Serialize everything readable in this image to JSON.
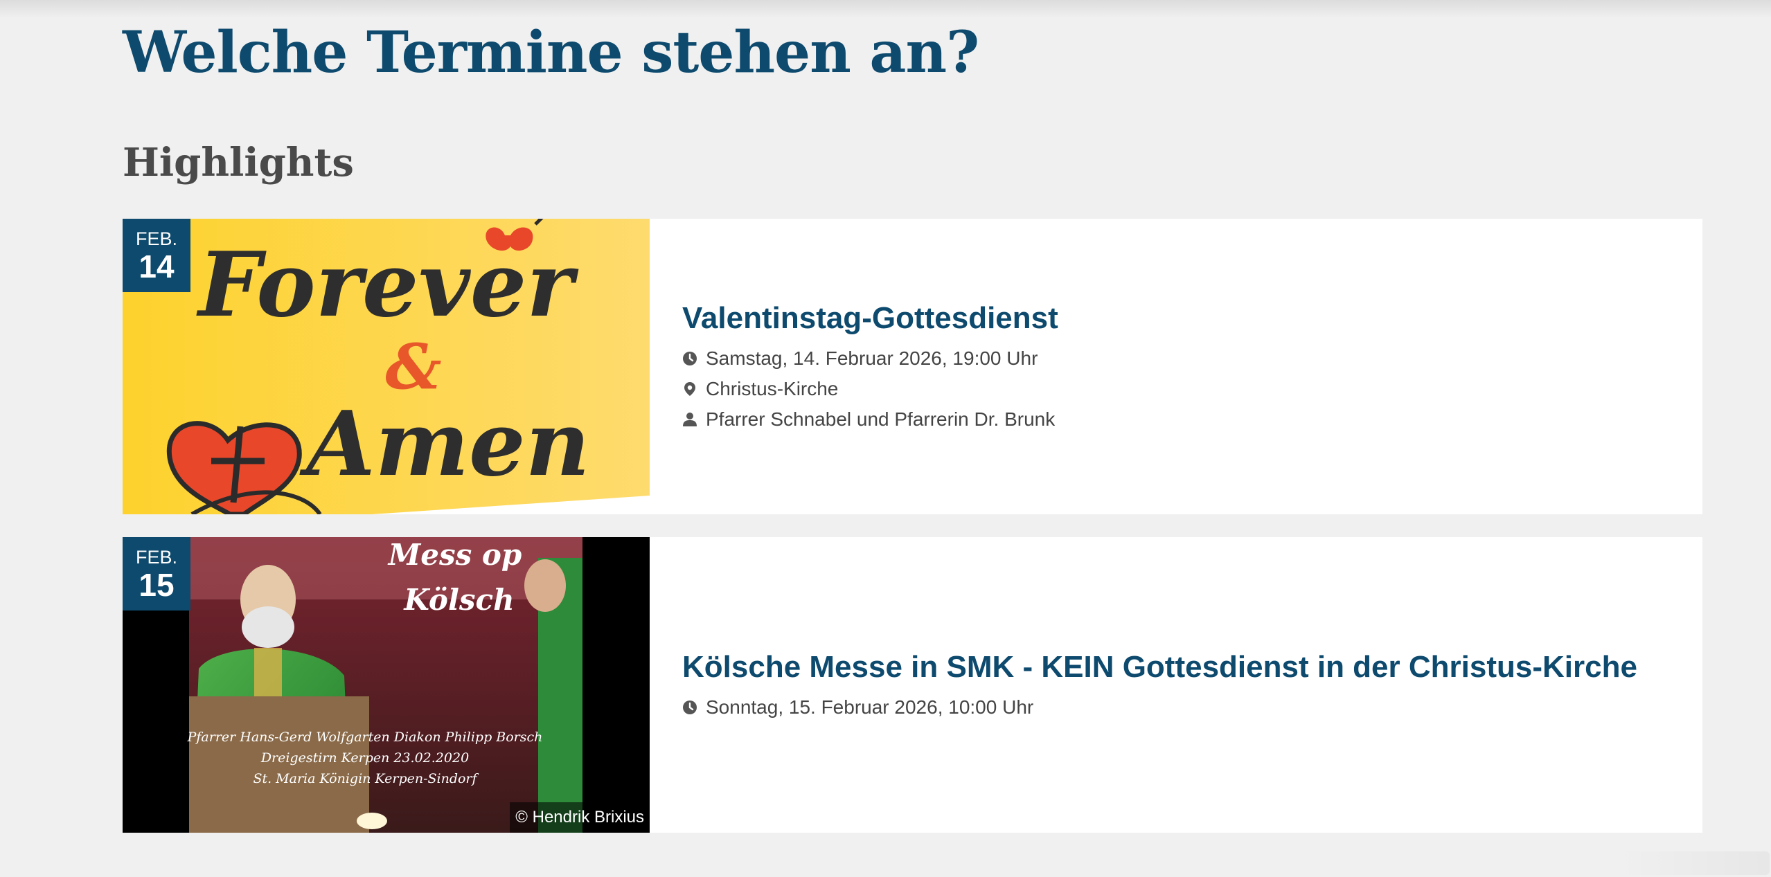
{
  "page": {
    "title": "Welche Termine stehen an?",
    "section_title": "Highlights"
  },
  "colors": {
    "accent": "#0d4a6e",
    "background": "#f0f0f0",
    "card": "#ffffff",
    "section_title": "#4a4a4a"
  },
  "events": [
    {
      "month": "FEB.",
      "day": "14",
      "title": "Valentinstag-Gottesdienst",
      "datetime": "Samstag, 14. Februar 2026, 19:00 Uhr",
      "location": "Christus-Kirche",
      "person": "Pfarrer Schnabel und Pfarrerin Dr. Brunk",
      "image": {
        "line1": "Forever",
        "ampersand": "&",
        "line2": "Amen"
      }
    },
    {
      "month": "FEB.",
      "day": "15",
      "title": "Kölsche Messe in SMK - KEIN Gottesdienst in der Christus-Kirche",
      "datetime": "Sonntag, 15. Februar 2026, 10:00 Uhr",
      "image": {
        "line1": "Mess op",
        "line2": "Kölsch",
        "caption1": "Pfarrer Hans-Gerd Wolfgarten  Diakon Philipp Borsch",
        "caption2": "Dreigestirn Kerpen 23.02.2020",
        "caption3": "St. Maria Königin Kerpen-Sindorf",
        "credit": "© Hendrik Brixius"
      }
    }
  ],
  "icons": {
    "time": "clock-icon",
    "location": "map-pin-icon",
    "person": "person-icon"
  }
}
